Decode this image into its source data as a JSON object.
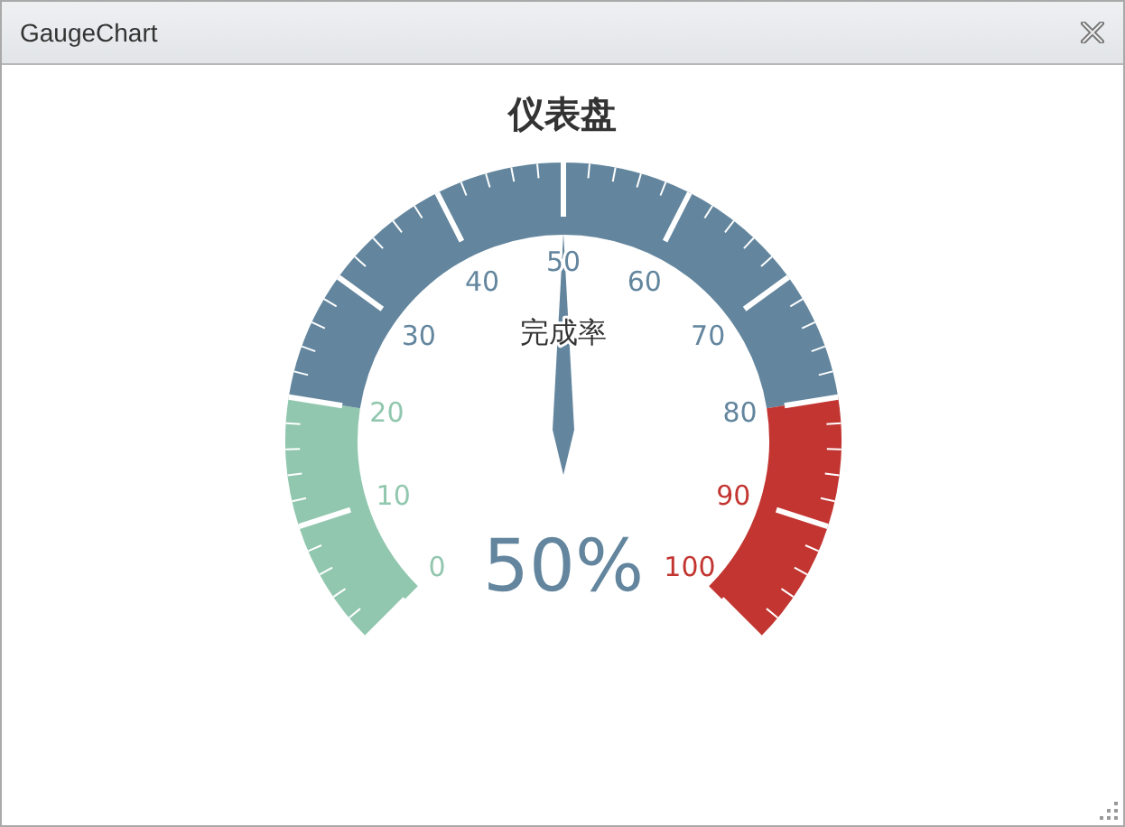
{
  "window": {
    "title": "GaugeChart"
  },
  "chart": {
    "title": "仪表盘"
  },
  "gauge": {
    "name": "完成率",
    "reading": "50%",
    "level": 0.5,
    "tick_labels": [
      {
        "label": "0",
        "color": "#91c7ae"
      },
      {
        "label": "10",
        "color": "#91c7ae"
      },
      {
        "label": "20",
        "color": "#91c7ae"
      },
      {
        "label": "30",
        "color": "#63869e"
      },
      {
        "label": "40",
        "color": "#63869e"
      },
      {
        "label": "50",
        "color": "#63869e"
      },
      {
        "label": "60",
        "color": "#63869e"
      },
      {
        "label": "70",
        "color": "#63869e"
      },
      {
        "label": "80",
        "color": "#63869e"
      },
      {
        "label": "90",
        "color": "#c23531"
      },
      {
        "label": "100",
        "color": "#c23531"
      }
    ]
  }
}
